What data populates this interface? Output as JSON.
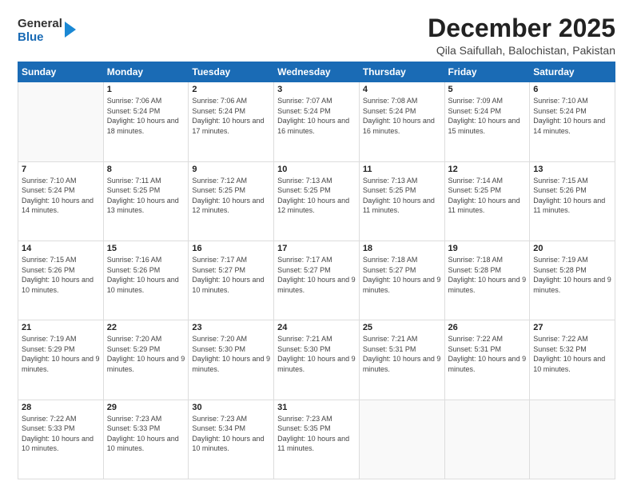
{
  "header": {
    "logo_general": "General",
    "logo_blue": "Blue",
    "title": "December 2025",
    "subtitle": "Qila Saifullah, Balochistan, Pakistan"
  },
  "weekdays": [
    "Sunday",
    "Monday",
    "Tuesday",
    "Wednesday",
    "Thursday",
    "Friday",
    "Saturday"
  ],
  "weeks": [
    [
      {
        "day": "",
        "sunrise": "",
        "sunset": "",
        "daylight": ""
      },
      {
        "day": "1",
        "sunrise": "7:06 AM",
        "sunset": "5:24 PM",
        "daylight": "10 hours and 18 minutes."
      },
      {
        "day": "2",
        "sunrise": "7:06 AM",
        "sunset": "5:24 PM",
        "daylight": "10 hours and 17 minutes."
      },
      {
        "day": "3",
        "sunrise": "7:07 AM",
        "sunset": "5:24 PM",
        "daylight": "10 hours and 16 minutes."
      },
      {
        "day": "4",
        "sunrise": "7:08 AM",
        "sunset": "5:24 PM",
        "daylight": "10 hours and 16 minutes."
      },
      {
        "day": "5",
        "sunrise": "7:09 AM",
        "sunset": "5:24 PM",
        "daylight": "10 hours and 15 minutes."
      },
      {
        "day": "6",
        "sunrise": "7:10 AM",
        "sunset": "5:24 PM",
        "daylight": "10 hours and 14 minutes."
      }
    ],
    [
      {
        "day": "7",
        "sunrise": "7:10 AM",
        "sunset": "5:24 PM",
        "daylight": "10 hours and 14 minutes."
      },
      {
        "day": "8",
        "sunrise": "7:11 AM",
        "sunset": "5:25 PM",
        "daylight": "10 hours and 13 minutes."
      },
      {
        "day": "9",
        "sunrise": "7:12 AM",
        "sunset": "5:25 PM",
        "daylight": "10 hours and 12 minutes."
      },
      {
        "day": "10",
        "sunrise": "7:13 AM",
        "sunset": "5:25 PM",
        "daylight": "10 hours and 12 minutes."
      },
      {
        "day": "11",
        "sunrise": "7:13 AM",
        "sunset": "5:25 PM",
        "daylight": "10 hours and 11 minutes."
      },
      {
        "day": "12",
        "sunrise": "7:14 AM",
        "sunset": "5:25 PM",
        "daylight": "10 hours and 11 minutes."
      },
      {
        "day": "13",
        "sunrise": "7:15 AM",
        "sunset": "5:26 PM",
        "daylight": "10 hours and 11 minutes."
      }
    ],
    [
      {
        "day": "14",
        "sunrise": "7:15 AM",
        "sunset": "5:26 PM",
        "daylight": "10 hours and 10 minutes."
      },
      {
        "day": "15",
        "sunrise": "7:16 AM",
        "sunset": "5:26 PM",
        "daylight": "10 hours and 10 minutes."
      },
      {
        "day": "16",
        "sunrise": "7:17 AM",
        "sunset": "5:27 PM",
        "daylight": "10 hours and 10 minutes."
      },
      {
        "day": "17",
        "sunrise": "7:17 AM",
        "sunset": "5:27 PM",
        "daylight": "10 hours and 9 minutes."
      },
      {
        "day": "18",
        "sunrise": "7:18 AM",
        "sunset": "5:27 PM",
        "daylight": "10 hours and 9 minutes."
      },
      {
        "day": "19",
        "sunrise": "7:18 AM",
        "sunset": "5:28 PM",
        "daylight": "10 hours and 9 minutes."
      },
      {
        "day": "20",
        "sunrise": "7:19 AM",
        "sunset": "5:28 PM",
        "daylight": "10 hours and 9 minutes."
      }
    ],
    [
      {
        "day": "21",
        "sunrise": "7:19 AM",
        "sunset": "5:29 PM",
        "daylight": "10 hours and 9 minutes."
      },
      {
        "day": "22",
        "sunrise": "7:20 AM",
        "sunset": "5:29 PM",
        "daylight": "10 hours and 9 minutes."
      },
      {
        "day": "23",
        "sunrise": "7:20 AM",
        "sunset": "5:30 PM",
        "daylight": "10 hours and 9 minutes."
      },
      {
        "day": "24",
        "sunrise": "7:21 AM",
        "sunset": "5:30 PM",
        "daylight": "10 hours and 9 minutes."
      },
      {
        "day": "25",
        "sunrise": "7:21 AM",
        "sunset": "5:31 PM",
        "daylight": "10 hours and 9 minutes."
      },
      {
        "day": "26",
        "sunrise": "7:22 AM",
        "sunset": "5:31 PM",
        "daylight": "10 hours and 9 minutes."
      },
      {
        "day": "27",
        "sunrise": "7:22 AM",
        "sunset": "5:32 PM",
        "daylight": "10 hours and 10 minutes."
      }
    ],
    [
      {
        "day": "28",
        "sunrise": "7:22 AM",
        "sunset": "5:33 PM",
        "daylight": "10 hours and 10 minutes."
      },
      {
        "day": "29",
        "sunrise": "7:23 AM",
        "sunset": "5:33 PM",
        "daylight": "10 hours and 10 minutes."
      },
      {
        "day": "30",
        "sunrise": "7:23 AM",
        "sunset": "5:34 PM",
        "daylight": "10 hours and 10 minutes."
      },
      {
        "day": "31",
        "sunrise": "7:23 AM",
        "sunset": "5:35 PM",
        "daylight": "10 hours and 11 minutes."
      },
      {
        "day": "",
        "sunrise": "",
        "sunset": "",
        "daylight": ""
      },
      {
        "day": "",
        "sunrise": "",
        "sunset": "",
        "daylight": ""
      },
      {
        "day": "",
        "sunrise": "",
        "sunset": "",
        "daylight": ""
      }
    ]
  ]
}
